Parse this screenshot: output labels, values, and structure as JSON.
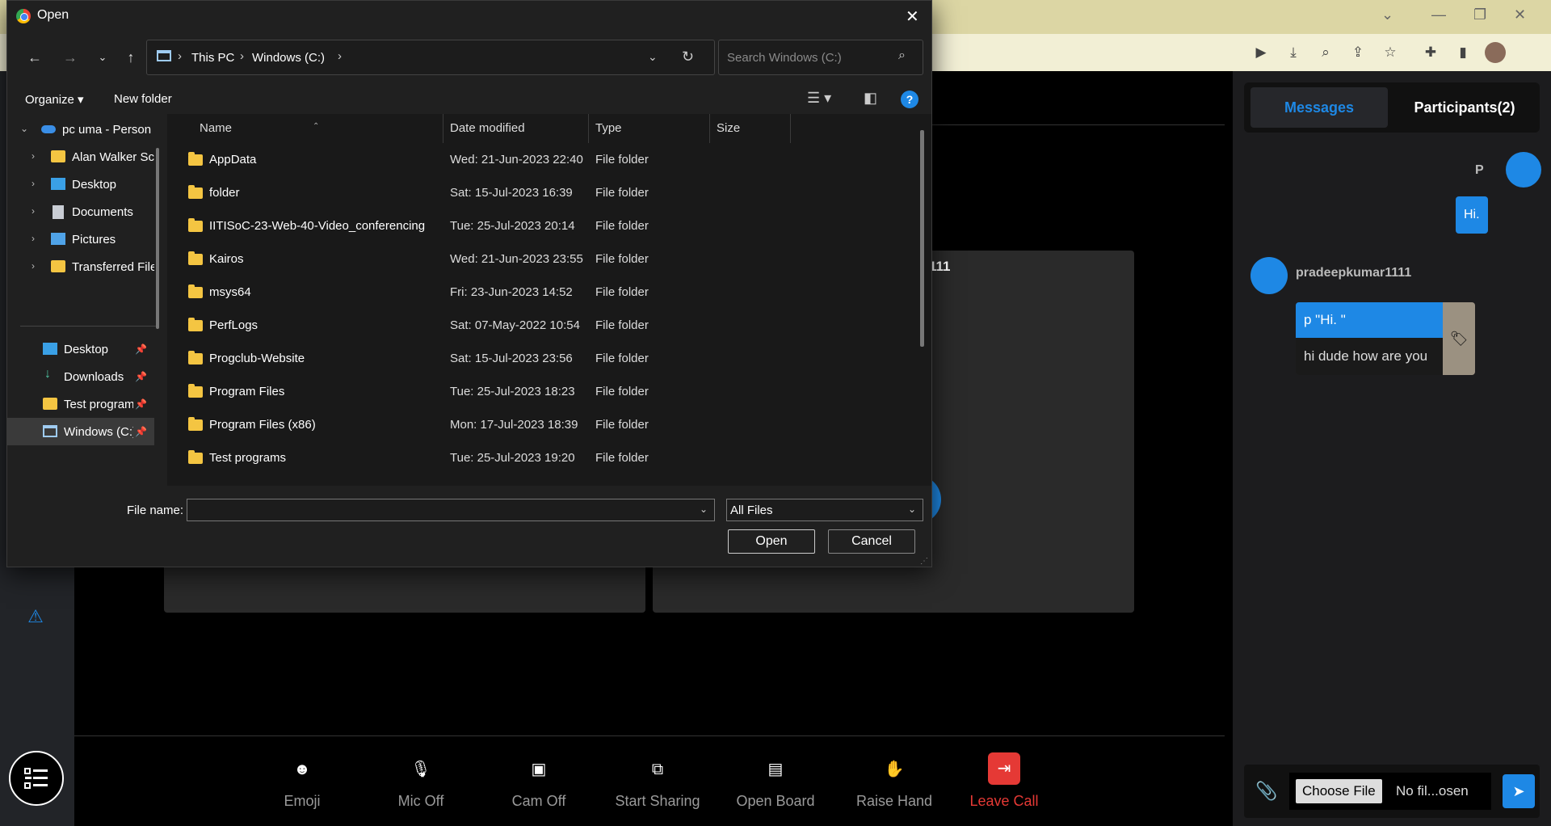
{
  "dialog": {
    "title": "Open",
    "crumbs": [
      "This PC",
      "Windows (C:)"
    ],
    "search_placeholder": "Search Windows (C:)",
    "organize": "Organize",
    "new_folder": "New folder",
    "nav": [
      {
        "label": "pc uma - Person",
        "type": "onedrive"
      },
      {
        "label": "Alan Walker Sc",
        "type": "folder"
      },
      {
        "label": "Desktop",
        "type": "desktop"
      },
      {
        "label": "Documents",
        "type": "documents"
      },
      {
        "label": "Pictures",
        "type": "pictures"
      },
      {
        "label": "Transferred File",
        "type": "folder"
      },
      {
        "label": "Desktop",
        "type": "desktop"
      },
      {
        "label": "Downloads",
        "type": "downloads"
      },
      {
        "label": "Test program",
        "type": "folder"
      },
      {
        "label": "Windows (C:)",
        "type": "drive"
      }
    ],
    "columns": [
      "Name",
      "Date modified",
      "Type",
      "Size"
    ],
    "files": [
      {
        "name": "AppData",
        "date": "Wed: 21-Jun-2023 22:40",
        "type": "File folder"
      },
      {
        "name": "folder",
        "date": "Sat: 15-Jul-2023 16:39",
        "type": "File folder"
      },
      {
        "name": "IITISoC-23-Web-40-Video_conferencing",
        "date": "Tue: 25-Jul-2023 20:14",
        "type": "File folder"
      },
      {
        "name": "Kairos",
        "date": "Wed: 21-Jun-2023 23:55",
        "type": "File folder"
      },
      {
        "name": "msys64",
        "date": "Fri: 23-Jun-2023 14:52",
        "type": "File folder"
      },
      {
        "name": "PerfLogs",
        "date": "Sat: 07-May-2022 10:54",
        "type": "File folder"
      },
      {
        "name": "Progclub-Website",
        "date": "Sat: 15-Jul-2023 23:56",
        "type": "File folder"
      },
      {
        "name": "Program Files",
        "date": "Tue: 25-Jul-2023 18:23",
        "type": "File folder"
      },
      {
        "name": "Program Files (x86)",
        "date": "Mon: 17-Jul-2023 18:39",
        "type": "File folder"
      },
      {
        "name": "Test programs",
        "date": "Tue: 25-Jul-2023 19:20",
        "type": "File folder"
      }
    ],
    "file_name_label": "File name:",
    "file_name_value": "",
    "file_type": "All Files",
    "open_label": "Open",
    "cancel_label": "Cancel"
  },
  "call": {
    "participant_name_fragment": "111",
    "controls": [
      {
        "label": "Emoji",
        "icon": "emoji-icon"
      },
      {
        "label": "Mic Off",
        "icon": "mic-off-icon"
      },
      {
        "label": "Cam Off",
        "icon": "cam-off-icon"
      },
      {
        "label": "Start Sharing",
        "icon": "screen-share-icon"
      },
      {
        "label": "Open Board",
        "icon": "clipboard-icon"
      },
      {
        "label": "Raise Hand",
        "icon": "hand-icon"
      },
      {
        "label": "Leave Call",
        "icon": "leave-icon"
      }
    ]
  },
  "chat": {
    "tab_messages": "Messages",
    "tab_participants": "Participants(2)",
    "self_initial": "P",
    "self_message": "Hi.",
    "other_name": "pradeepkumar1111",
    "reply_quote": "p \"Hi. \"",
    "reply_text": "hi dude how are you",
    "choose_file": "Choose File",
    "no_file": "No fil...osen"
  },
  "colors": {
    "accent": "#1e88e5",
    "leave": "#e53935",
    "folder": "#f4c542"
  }
}
